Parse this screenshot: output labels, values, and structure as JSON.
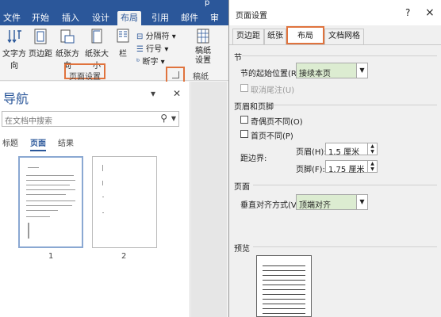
{
  "word": {
    "title_fragment": "p",
    "tabs": [
      "文件",
      "开始",
      "插入",
      "设计",
      "布局",
      "引用",
      "邮件",
      "审阅"
    ],
    "active_tab": "布局",
    "ribbon": {
      "text_direction": "文字方向",
      "margins": "页边距",
      "orientation": "纸张方向",
      "size": "纸张大小",
      "columns": "栏",
      "breaks": "分隔符",
      "line_numbers": "行号",
      "hyphenation": "断字",
      "draft_settings": "稿纸设置",
      "page_setup_group": "页面设置",
      "draft_group": "稿纸"
    }
  },
  "nav": {
    "title": "导航",
    "search_placeholder": "在文档中搜索",
    "tabs": [
      "标题",
      "页面",
      "结果"
    ],
    "active_tab": "页面",
    "page_numbers": [
      "1",
      "2"
    ]
  },
  "dialog": {
    "title": "页面设置",
    "help": "?",
    "close": "×",
    "tabs": [
      "页边距",
      "纸张",
      "布局",
      "文档网格"
    ],
    "active_tab": "布局",
    "section": {
      "header": "节",
      "start_label": "节的起始位置(R):",
      "start_value": "接续本页",
      "suppress_endnotes": "取消尾注(U)"
    },
    "headers_footers": {
      "header": "页眉和页脚",
      "odd_even": "奇偶页不同(O)",
      "first_page": "首页不同(P)",
      "from_edge": "距边界:",
      "header_label": "页眉(H):",
      "header_value": "1.5 厘米",
      "footer_label": "页脚(F):",
      "footer_value": "1.75 厘米"
    },
    "page": {
      "header": "页面",
      "valign_label": "垂直对齐方式(V):",
      "valign_value": "顶端对齐"
    },
    "preview": {
      "header": "预览"
    }
  },
  "colors": {
    "word_blue": "#2b579a",
    "highlight": "#e0733d",
    "select_green": "#dcecd1"
  }
}
